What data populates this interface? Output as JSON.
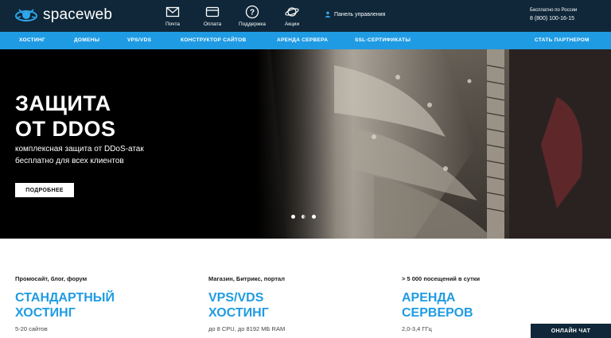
{
  "header": {
    "logo_text": "spaceweb",
    "icons": [
      {
        "icon": "envelope-icon",
        "label": "Почта"
      },
      {
        "icon": "card-icon",
        "label": "Оплата"
      },
      {
        "icon": "question-icon",
        "label": "Поддержка"
      },
      {
        "icon": "planet-icon",
        "label": "Акции"
      }
    ],
    "panel_label": "Панель управления",
    "phone_caption": "Бесплатно по России",
    "phone_number": "8 (800) 100-16-15"
  },
  "nav": {
    "items": [
      "ХОСТИНГ",
      "ДОМЕНЫ",
      "VPS/VDS",
      "КОНСТРУКТОР САЙТОВ",
      "АРЕНДА СЕРВЕРА",
      "SSL-СЕРТИФИКАТЫ"
    ],
    "partner": "СТАТЬ ПАРТНЕРОМ"
  },
  "hero": {
    "title_line1": "ЗАЩИТА",
    "title_line2": "ОТ DDOS",
    "sub_line1": "комплексная защита от DDoS-атак",
    "sub_line2": "бесплатно для всех клиентов",
    "button": "ПОДРОБНЕЕ",
    "slides_total": 3,
    "active_slide": 2
  },
  "products": [
    {
      "category": "Промосайт, блог, форум",
      "name_line1": "СТАНДАРТНЫЙ",
      "name_line2": "ХОСТИНГ",
      "spec": "5-20 сайтов"
    },
    {
      "category": "Магазин, Битрикс, портал",
      "name_line1": "VPS/VDS",
      "name_line2": "ХОСТИНГ",
      "spec": "до 8 CPU, до 8192 МБ RAM"
    },
    {
      "category": "> 5 000 посещений в сутки",
      "name_line1": "АРЕНДА",
      "name_line2": "СЕРВЕРОВ",
      "spec": "2,0-3,4 ГГц"
    }
  ],
  "chat_label": "ОНЛАЙН ЧАТ",
  "colors": {
    "header_bg": "#0f2738",
    "accent": "#1f9be3"
  }
}
